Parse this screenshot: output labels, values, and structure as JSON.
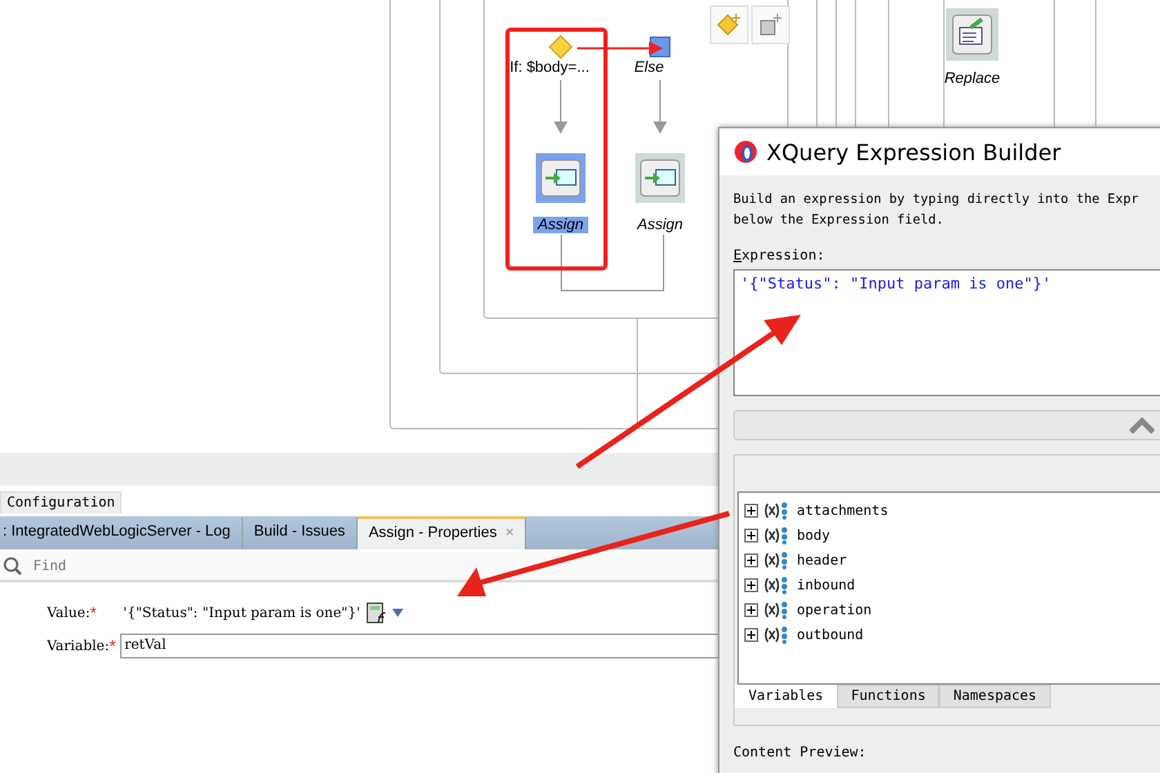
{
  "diagram": {
    "branches": [
      {
        "kind": "if",
        "label": "If: $body=...",
        "activity": "Assign",
        "selected": true
      },
      {
        "kind": "else",
        "label": "Else",
        "activity": "Assign",
        "selected": false
      }
    ],
    "replace": {
      "label": "Replace"
    }
  },
  "bottom_panel": {
    "config_tab": "Configuration",
    "tabs": [
      {
        "label": ": IntegratedWebLogicServer - Log",
        "selected": false
      },
      {
        "label": "Build - Issues",
        "selected": false
      },
      {
        "label": "Assign - Properties",
        "selected": true,
        "close": "×"
      }
    ],
    "find": {
      "placeholder": "Find"
    },
    "fields": [
      {
        "kind": "text",
        "label": "Value:",
        "mark": "*",
        "value": "'{\"Status\": \"Input param is one\"}'"
      },
      {
        "kind": "input",
        "label": "Variable:",
        "mark": "*",
        "value": "retVal"
      }
    ]
  },
  "dialog": {
    "title": "XQuery Expression Builder",
    "instructions": [
      "Build an expression by typing directly into the Expr",
      "below the Expression field."
    ],
    "expression_label": "Expression:",
    "expression": "'{\"Status\": \"Input param is one\"}'",
    "tree": [
      {
        "label": "attachments",
        "expanded": false
      },
      {
        "label": "body",
        "expanded": false
      },
      {
        "label": "header",
        "expanded": false
      },
      {
        "label": "inbound",
        "expanded": false
      },
      {
        "label": "operation",
        "expanded": false
      },
      {
        "label": "outbound",
        "expanded": false
      }
    ],
    "tabs": [
      {
        "label": "Variables",
        "selected": true
      },
      {
        "label": "Functions",
        "selected": false
      },
      {
        "label": "Namespaces",
        "selected": false
      }
    ],
    "preview_label": "Content Preview:"
  }
}
